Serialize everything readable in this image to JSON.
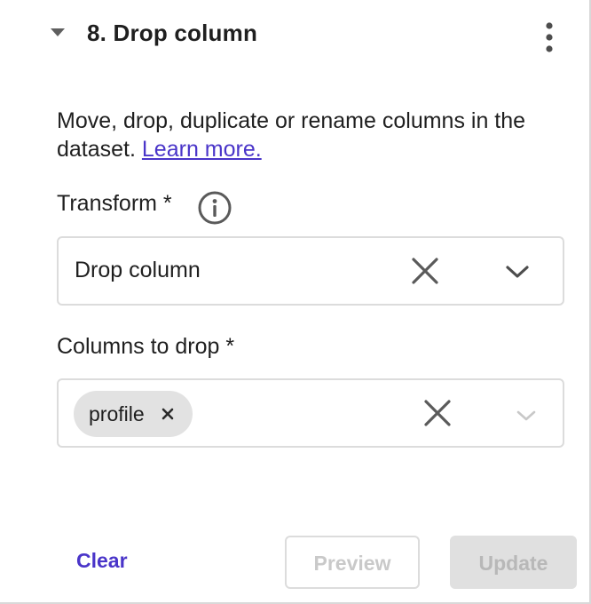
{
  "step": {
    "title": "8. Drop column"
  },
  "description": {
    "text": "Move, drop, duplicate or rename columns in the dataset.",
    "link_label": "Learn more."
  },
  "transform_field": {
    "label": "Transform *",
    "value": "Drop column"
  },
  "columns_field": {
    "label": "Columns to drop *",
    "chips": [
      "profile"
    ]
  },
  "footer": {
    "clear_label": "Clear",
    "preview_label": "Preview",
    "update_label": "Update"
  },
  "colors": {
    "accent": "#4a35c9",
    "disabled_text": "#b8b8b8",
    "border": "#dcdcdc",
    "chip_bg": "#e2e2e2"
  },
  "icons": {
    "collapse": "caret-down-icon",
    "more": "kebab-menu-icon",
    "info": "info-icon",
    "clear": "close-icon",
    "dropdown": "chevron-down-icon",
    "chip_remove": "chip-remove-icon"
  }
}
